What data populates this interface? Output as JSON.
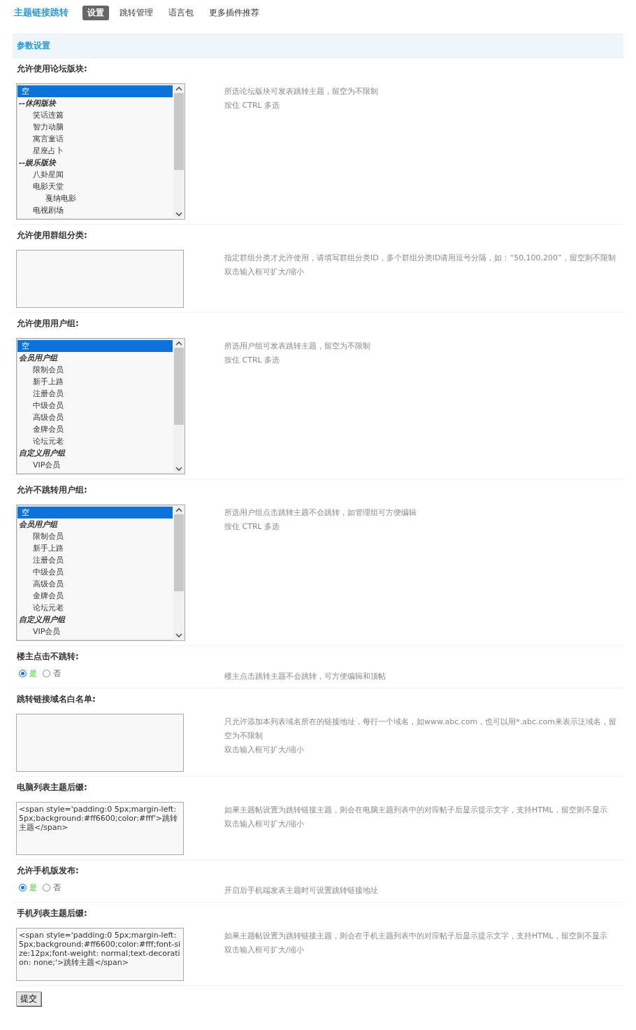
{
  "header": {
    "title": "主题链接跳转",
    "tabs": [
      {
        "label": "设置",
        "selected": true
      },
      {
        "label": "跳转管理",
        "selected": false
      },
      {
        "label": "语言包",
        "selected": false
      },
      {
        "label": "更多插件推荐",
        "selected": false
      }
    ]
  },
  "panel_title": "参数设置",
  "settings": [
    {
      "kind": "select",
      "label": "允许使用论坛版块:",
      "options": [
        {
          "label": "空",
          "selected": true
        },
        {
          "label": "--休闲版块",
          "group": true,
          "selected": false,
          "children": [
            {
              "label": "笑话连篇",
              "selected": false
            },
            {
              "label": "智力动脑",
              "selected": false
            },
            {
              "label": "寓言童话",
              "selected": false
            },
            {
              "label": "星座占卜",
              "selected": false
            }
          ]
        },
        {
          "label": "--娱乐版块",
          "group": true,
          "selected": false,
          "children": [
            {
              "label": "八卦星闻",
              "selected": false
            },
            {
              "label": "电影天堂",
              "selected": false,
              "children": [
                {
                  "label": "戛纳电影",
                  "selected": false
                }
              ]
            },
            {
              "label": "电视剧场",
              "selected": false
            }
          ]
        }
      ],
      "description": [
        "所选论坛版块可发表跳转主题，留空为不限制",
        "按住 CTRL 多选"
      ]
    },
    {
      "kind": "textarea",
      "label": "允许使用群组分类:",
      "description": [
        "指定群组分类才允许使用，请填写群组分类ID，多个群组分类ID请用逗号分隔，如：“50,100,200”，留空则不限制",
        "双击输入框可扩大/缩小"
      ]
    },
    {
      "kind": "select",
      "label": "允许使用用户组:",
      "options": [
        {
          "label": "空",
          "selected": true
        },
        {
          "label": "会员用户组",
          "group": true,
          "selected": false,
          "children": [
            {
              "label": "限制会员",
              "selected": false
            },
            {
              "label": "新手上路",
              "selected": false
            },
            {
              "label": "注册会员",
              "selected": false
            },
            {
              "label": "中级会员",
              "selected": false
            },
            {
              "label": "高级会员",
              "selected": false
            },
            {
              "label": "金牌会员",
              "selected": false
            },
            {
              "label": "论坛元老",
              "selected": false
            }
          ]
        },
        {
          "label": "自定义用户组",
          "group": true,
          "selected": false,
          "children": [
            {
              "label": "VIP会员",
              "selected": false
            }
          ]
        }
      ],
      "description": [
        "所选用户组可发表跳转主题，留空为不限制",
        "按住 CTRL 多选"
      ]
    },
    {
      "kind": "select",
      "label": "允许不跳转用户组:",
      "options": [
        {
          "label": "空",
          "selected": true
        },
        {
          "label": "会员用户组",
          "group": true,
          "selected": false,
          "children": [
            {
              "label": "限制会员",
              "selected": false
            },
            {
              "label": "新手上路",
              "selected": false
            },
            {
              "label": "注册会员",
              "selected": false
            },
            {
              "label": "中级会员",
              "selected": false
            },
            {
              "label": "高级会员",
              "selected": false
            },
            {
              "label": "金牌会员",
              "selected": false
            },
            {
              "label": "论坛元老",
              "selected": false
            }
          ]
        },
        {
          "label": "自定义用户组",
          "group": true,
          "selected": false,
          "children": [
            {
              "label": "VIP会员",
              "selected": false
            }
          ]
        }
      ],
      "description": [
        "所选用户组点击跳转主题不会跳转，如管理组可方便编辑",
        "按住 CTRL 多选"
      ]
    },
    {
      "kind": "radio",
      "label": "楼主点击不跳转:",
      "choices": [
        {
          "label": "是",
          "selected": true
        },
        {
          "label": "否",
          "selected": false
        }
      ],
      "description": [
        "楼主点击跳转主题不会跳转，可方便编辑和顶帖"
      ]
    },
    {
      "kind": "textarea",
      "label": "跳转链接域名白名单:",
      "description": [
        "只允许添加本列表域名所在的链接地址，每行一个域名，如www.abc.com，也可以用*.abc.com来表示泛域名，留空为不限制",
        "双击输入框可扩大/缩小"
      ]
    },
    {
      "kind": "textarea",
      "label": "电脑列表主题后缀:",
      "value": "<span style='padding:0 5px;margin-left:5px;background:#ff6600;color:#fff'>跳转主题</span>",
      "description": [
        "如果主题帖设置为跳转链接主题，则会在电脑主题列表中的对应帖子后显示提示文字，支持HTML，留空则不显示",
        "双击输入框可扩大/缩小"
      ]
    },
    {
      "kind": "radio",
      "label": "允许手机版发布:",
      "choices": [
        {
          "label": "是",
          "selected": true
        },
        {
          "label": "否",
          "selected": false
        }
      ],
      "description": [
        "开启后手机端发表主题时可设置跳转链接地址"
      ]
    },
    {
      "kind": "textarea",
      "label": "手机列表主题后缀:",
      "value": "<span style='padding:0 5px;margin-left:5px;background:#ff6600;color:#fff;font-size:12px;font-weight: normal;text-decoration: none;'>跳转主题</span>",
      "description": [
        "如果主题帖设置为跳转链接主题，则会在手机主题列表中的对应帖子后显示提示文字，支持HTML，留空则不显示",
        "双击输入框可扩大/缩小"
      ]
    }
  ],
  "submit": "提交"
}
